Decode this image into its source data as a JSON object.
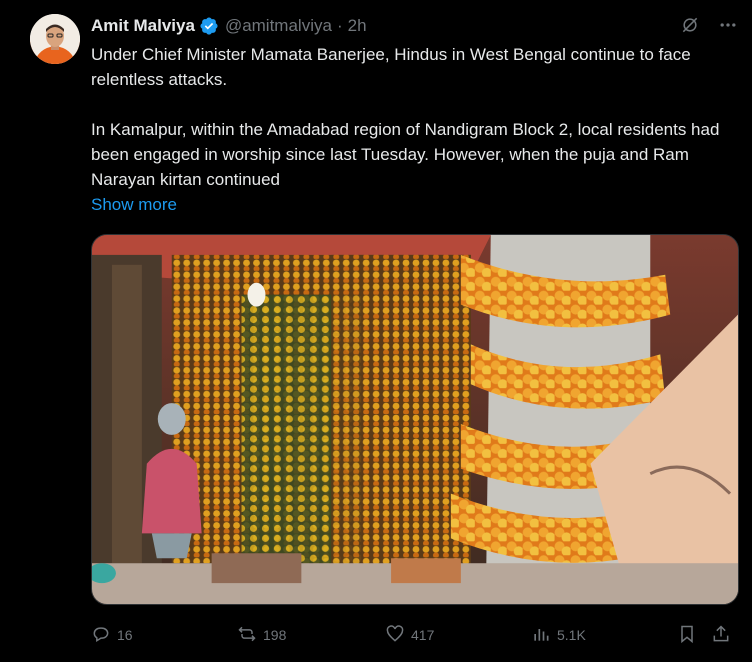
{
  "author": {
    "name": "Amit Malviya",
    "handle": "@amitmalviya",
    "separator": "·",
    "time": "2h"
  },
  "tweet": {
    "paragraph1": "Under Chief Minister Mamata Banerjee, Hindus in West Bengal continue to face relentless attacks.",
    "paragraph2": "In Kamalpur, within the Amadabad region of Nandigram Block 2, local residents had been engaged in worship since last Tuesday. However, when the puja and Ram Narayan kirtan continued",
    "show_more": "Show more"
  },
  "actions": {
    "replies": "16",
    "reposts": "198",
    "likes": "417",
    "views": "5.1K"
  },
  "icons": {
    "grok": "grok-icon",
    "more": "more-icon",
    "verified": "verified-badge-icon",
    "reply": "reply-icon",
    "repost": "repost-icon",
    "like": "like-icon",
    "views": "views-icon",
    "bookmark": "bookmark-icon",
    "share": "share-icon"
  },
  "colors": {
    "background": "#000000",
    "text": "#e7e9ea",
    "muted": "#71767b",
    "link": "#1d9bf0"
  }
}
